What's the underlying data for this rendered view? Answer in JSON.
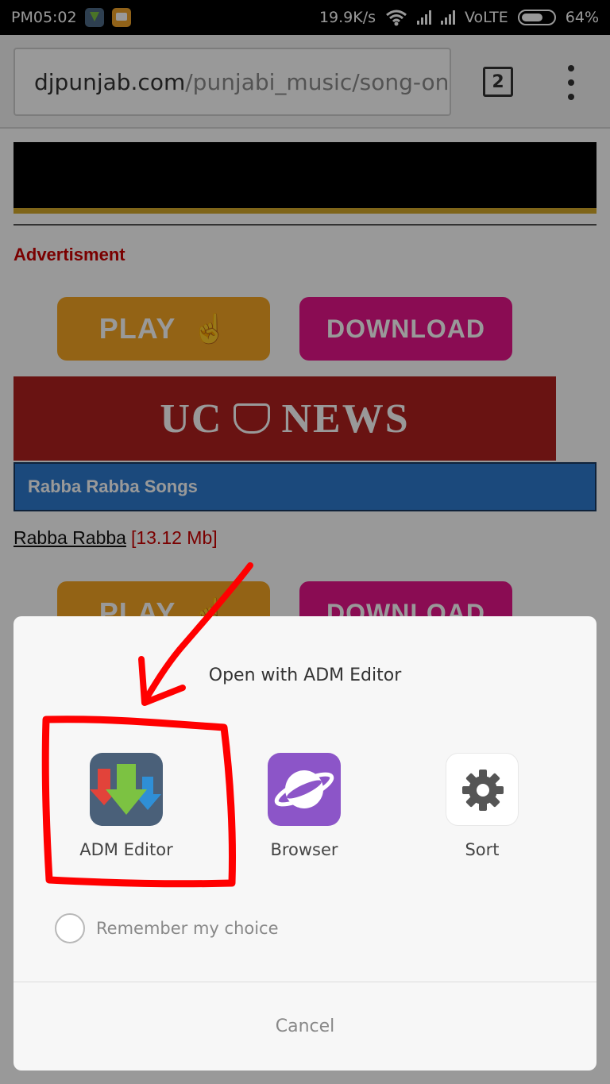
{
  "status_bar": {
    "time": "PM05:02",
    "net_speed": "19.9K/s",
    "network": "VoLTE",
    "battery": "64%",
    "icons": [
      "adm-notification-icon",
      "message-notification-icon",
      "wifi-icon",
      "signal-icon",
      "signal-icon",
      "battery-icon"
    ]
  },
  "browser": {
    "url_domain": "djpunjab.com",
    "url_path": "/punjabi_music/song-one-cl",
    "tab_count": "2"
  },
  "page": {
    "advertisement_label": "Advertisment",
    "play_label": "PLAY",
    "download_label": "DOWNLOAD",
    "ucnews_left": "UC",
    "ucnews_right": "NEWS",
    "section_title": "Rabba Rabba Songs",
    "song_name": "Rabba Rabba",
    "song_size": "[13.12 Mb]"
  },
  "dialog": {
    "title": "Open with ADM Editor",
    "apps": [
      {
        "label": "ADM Editor",
        "icon": "adm-editor-icon"
      },
      {
        "label": "Browser",
        "icon": "browser-planet-icon"
      },
      {
        "label": "Sort",
        "icon": "gear-icon"
      }
    ],
    "remember_label": "Remember my choice",
    "cancel_label": "Cancel"
  },
  "colors": {
    "accent_red": "#cc0000",
    "annotation_red": "#ff0000",
    "play_orange": "#f5a623",
    "download_pink": "#e6158a",
    "songbar_blue": "#2e7bcf"
  }
}
